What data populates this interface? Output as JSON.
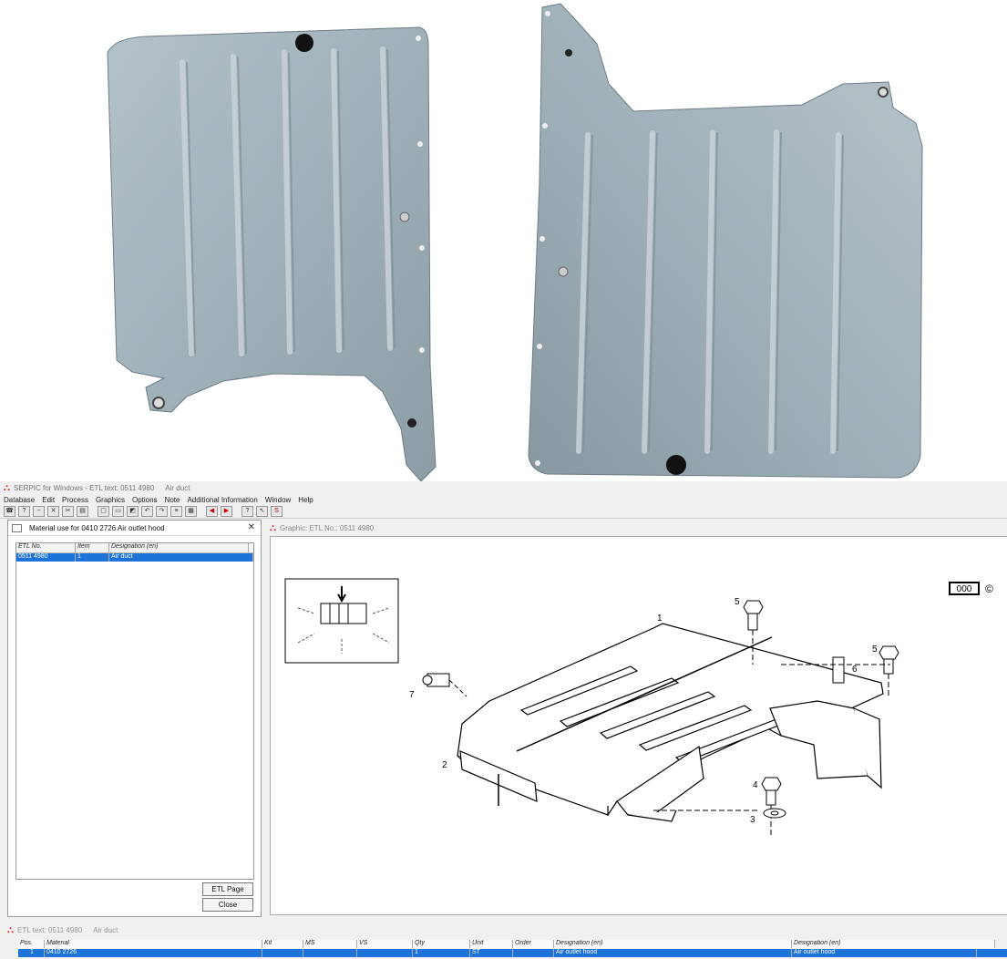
{
  "app": {
    "title": "SERPIC for Windows - ETL text: 0511 4980",
    "title_part": "Air duct",
    "menu": [
      "Database",
      "Edit",
      "Process",
      "Graphics",
      "Options",
      "Note",
      "Additional Information",
      "Window",
      "Help"
    ]
  },
  "material_panel": {
    "title": "Material use for 0410 2726 Air outlet hood",
    "columns": [
      "ETL No.",
      "Item",
      "Designation (en)"
    ],
    "rows": [
      {
        "etl": "0511 4980",
        "item": "1",
        "designation": "Air duct"
      }
    ],
    "etl_page_button": "ETL Page",
    "close_button": "Close"
  },
  "graphic_panel": {
    "title": "Graphic: ETL No.: 0511 4980",
    "code_box": "000",
    "copyright": "©",
    "callouts": [
      "1",
      "2",
      "3",
      "4",
      "5",
      "5",
      "6",
      "7"
    ]
  },
  "bottom_panel": {
    "title": "ETL text: 0511 4980",
    "title_part": "Air duct",
    "columns": [
      "Pos.",
      "Material",
      "Kit",
      "MS",
      "VS",
      "Qty",
      "Unit",
      "Order",
      "Designation (en)",
      "Designation (en)"
    ],
    "rows": [
      {
        "pos": "1",
        "material": "0410 2726",
        "kit": "",
        "ms": "",
        "vs": "",
        "qty": "1",
        "unit": "ST",
        "order": "",
        "des1": "Air outlet hood",
        "des2": "Air outlet hood"
      }
    ]
  },
  "colors": {
    "selection": "#1e73d8",
    "metal": "#a9b7bf",
    "logo": "#d33"
  }
}
